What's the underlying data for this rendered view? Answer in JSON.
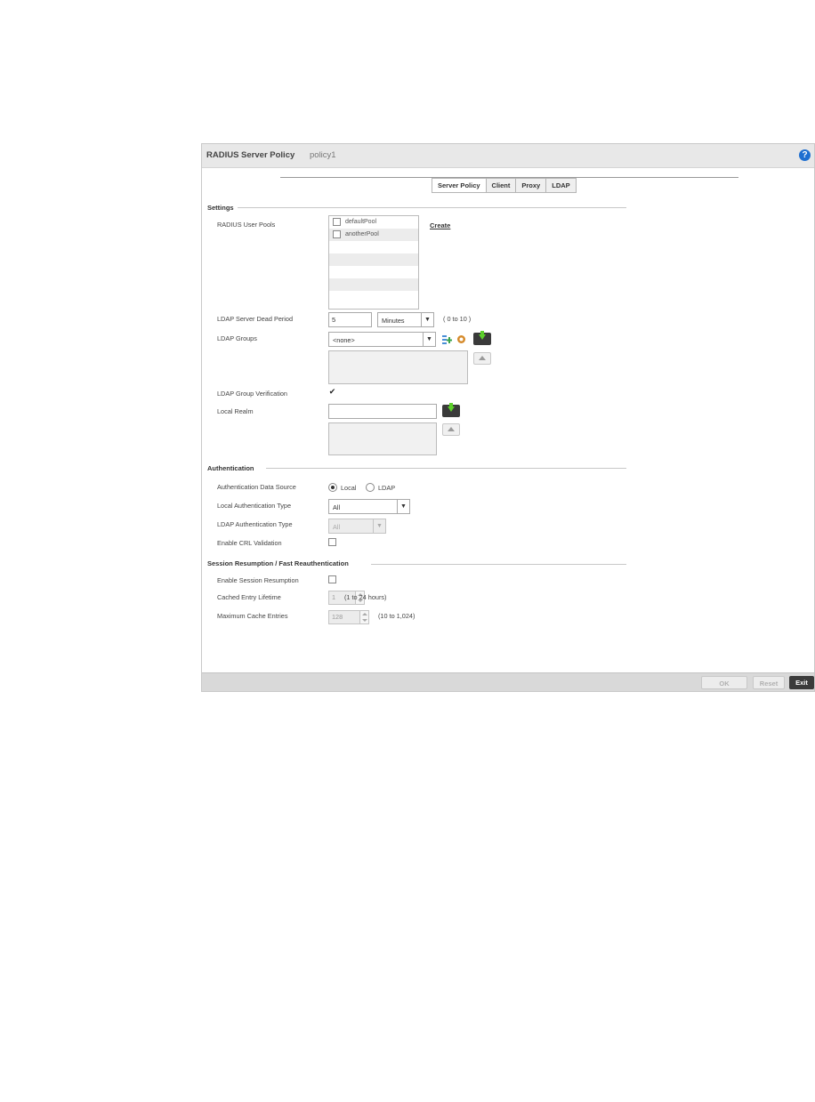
{
  "window": {
    "title": "RADIUS Server Policy",
    "policy_name": "policy1",
    "help_glyph": "?"
  },
  "tabs": [
    {
      "label": "Server Policy",
      "active": true
    },
    {
      "label": "Client",
      "active": false
    },
    {
      "label": "Proxy",
      "active": false
    },
    {
      "label": "LDAP",
      "active": false
    }
  ],
  "settings": {
    "heading": "Settings",
    "user_pools_label": "RADIUS User Pools",
    "user_pools": [
      {
        "name": "defaultPool",
        "checked": false
      },
      {
        "name": "anotherPool",
        "checked": false
      }
    ],
    "create_link": "Create",
    "dead_period_label": "LDAP Server Dead Period",
    "dead_period_value": "5",
    "dead_period_unit": "Minutes",
    "dead_period_hint": "( 0 to 10 )",
    "ldap_groups_label": "LDAP Groups",
    "ldap_groups_selected": "<none>",
    "ldap_group_verification_label": "LDAP Group Verification",
    "ldap_group_verification_checked": true,
    "local_realm_label": "Local Realm",
    "local_realm_value": ""
  },
  "authentication": {
    "heading": "Authentication",
    "data_source_label": "Authentication Data Source",
    "data_source_options": [
      "Local",
      "LDAP"
    ],
    "data_source_selected": "Local",
    "local_auth_type_label": "Local Authentication Type",
    "local_auth_type_value": "All",
    "ldap_auth_type_label": "LDAP Authentication Type",
    "ldap_auth_type_value": "All",
    "crl_label": "Enable CRL Validation",
    "crl_checked": false
  },
  "session": {
    "heading": "Session Resumption / Fast Reauthentication",
    "enable_label": "Enable Session Resumption",
    "enable_checked": false,
    "lifetime_label": "Cached Entry Lifetime",
    "lifetime_value": "1",
    "lifetime_hint": "(1 to 24 hours)",
    "max_entries_label": "Maximum Cache Entries",
    "max_entries_value": "128",
    "max_entries_hint": "(10 to 1,024)"
  },
  "footer": {
    "ok_label": "OK",
    "reset_label": "Reset",
    "exit_label": "Exit"
  },
  "icons": {
    "help": "help-icon",
    "add": "add-row-icon",
    "remove": "remove-row-icon",
    "create": "create-icon",
    "edit": "edit-icon"
  },
  "colors": {
    "help_blue": "#1f6fd0",
    "green_arrow": "#5ccf2a",
    "dark_button": "#3b3b3b"
  }
}
